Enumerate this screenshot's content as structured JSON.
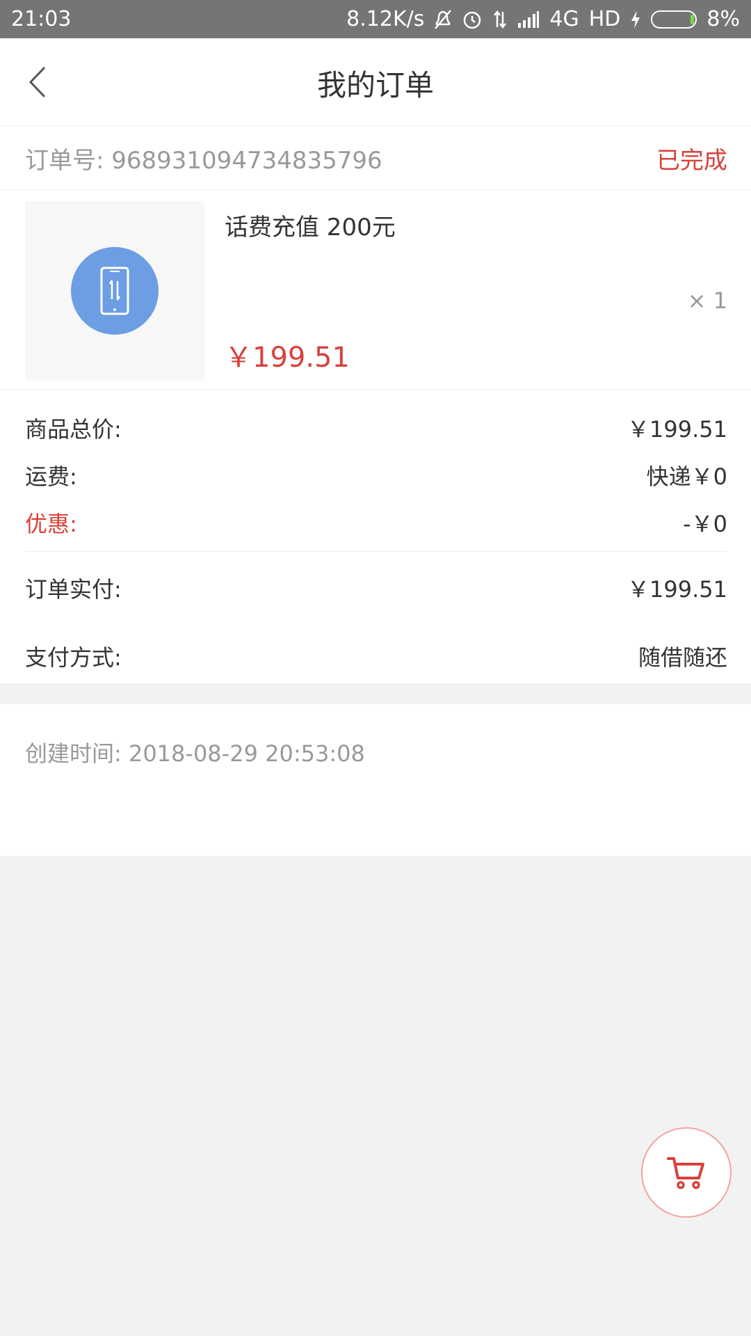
{
  "status_bar": {
    "time": "21:03",
    "net_speed": "8.12K/s",
    "network": "4G",
    "hd": "HD",
    "battery": "8%"
  },
  "header": {
    "title": "我的订单"
  },
  "order": {
    "number_label": "订单号: 968931094734835796",
    "status": "已完成"
  },
  "product": {
    "name": "话费充值 200元",
    "quantity": "× 1",
    "price": "￥199.51"
  },
  "summary": {
    "goods_total_label": "商品总价:",
    "goods_total_value": "￥199.51",
    "shipping_label": "运费:",
    "shipping_value": "快递￥0",
    "discount_label": "优惠:",
    "discount_value": "-￥0",
    "paid_label": "订单实付:",
    "paid_value": "￥199.51",
    "payment_method_label": "支付方式:",
    "payment_method_value": "随借随还"
  },
  "created": {
    "text": "创建时间: 2018-08-29 20:53:08"
  },
  "colors": {
    "accent_red": "#d8413a",
    "icon_blue": "#6d9ee3",
    "status_bar": "#757575"
  },
  "icons": [
    "back-arrow-icon",
    "phone-icon",
    "cart-icon",
    "mute-icon",
    "alarm-icon",
    "signal-icon",
    "battery-icon",
    "charging-icon"
  ]
}
